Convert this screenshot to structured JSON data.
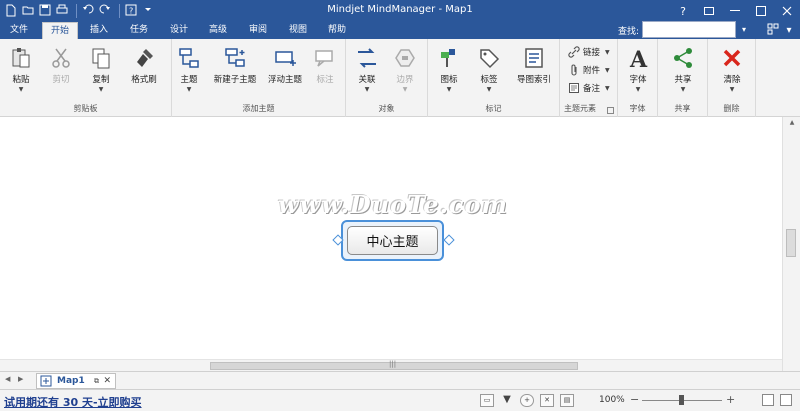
{
  "app": {
    "title": "Mindjet MindManager - Map1"
  },
  "qat": {
    "icons": [
      "new-file-icon",
      "open-file-icon",
      "save-icon",
      "print-icon",
      "undo-icon",
      "redo-icon",
      "help-icon",
      "customize-icon"
    ]
  },
  "tabs": [
    {
      "label": "文件"
    },
    {
      "label": "开始"
    },
    {
      "label": "插入"
    },
    {
      "label": "任务"
    },
    {
      "label": "设计"
    },
    {
      "label": "高级"
    },
    {
      "label": "审阅"
    },
    {
      "label": "视图"
    },
    {
      "label": "帮助"
    }
  ],
  "active_tab": "开始",
  "search": {
    "label": "查找:",
    "value": ""
  },
  "ribbon": {
    "clipboard": {
      "label": "剪贴板",
      "paste": "粘贴",
      "cut": "剪切",
      "copy": "复制",
      "format_painter": "格式刷"
    },
    "add_topic": {
      "label": "添加主题",
      "topic": "主题",
      "new_subtopic": "新建子主题",
      "floating_topic": "浮动主题",
      "callout": "标注"
    },
    "objects": {
      "label": "对象",
      "relationship": "关联",
      "boundary": "边界"
    },
    "markers": {
      "label": "标记",
      "icons": "图标",
      "tags": "标签",
      "map_index": "导图索引"
    },
    "topic_elements": {
      "label": "主题元素",
      "link": "链接",
      "attachment": "附件",
      "notes": "备注"
    },
    "font": {
      "label": "字体",
      "font": "字体"
    },
    "share": {
      "label": "共享",
      "share": "共享"
    },
    "delete": {
      "label": "删除",
      "clear": "清除"
    }
  },
  "canvas": {
    "central_topic": "中心主题",
    "watermark": "www.DuoTe.com"
  },
  "doc_tab": {
    "name": "Map1"
  },
  "status": {
    "trial": "试用期还有 30 天-立即购买",
    "zoom": "100%"
  },
  "colors": {
    "brand": "#2b579a",
    "ribbon_bg": "#f3f3f3",
    "topic_border": "#4a90d9",
    "trial_link": "#1f3f8f",
    "delete_red": "#d9261c",
    "share_green": "#2e8b3a"
  }
}
